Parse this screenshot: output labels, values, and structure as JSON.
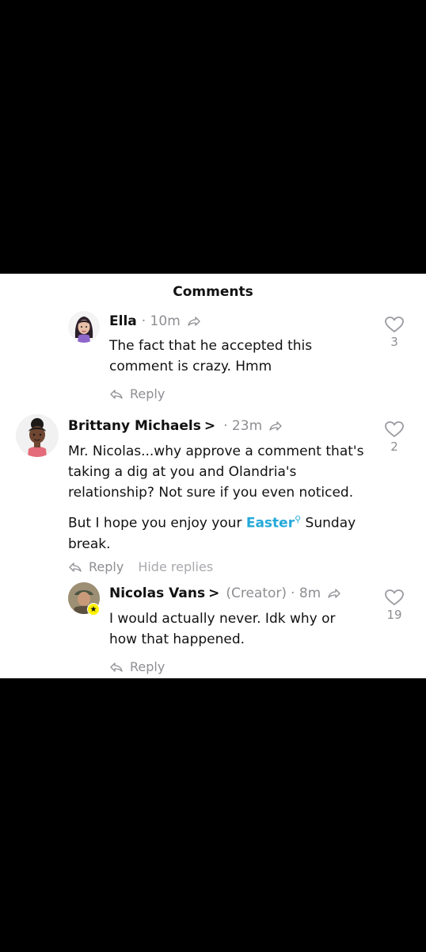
{
  "header": {
    "title": "Comments"
  },
  "comments": [
    {
      "name": "Ella",
      "time": "· 10m",
      "lines": [
        "The fact that he accepted this comment is crazy. Hmm"
      ],
      "likes": "3",
      "reply_label": "Reply"
    },
    {
      "name": "Brittany Michaels",
      "chevron": ">",
      "time": "· 23m",
      "para1": "Mr. Nicolas...why approve a comment that's taking a dig at you and Olandria's relationship? Not sure if you even noticed.",
      "para2_pre": "But I hope you enjoy your ",
      "para2_link": "Easter",
      "para2_post": " Sunday break.",
      "likes": "2",
      "reply_label": "Reply",
      "hide_label": "Hide replies"
    },
    {
      "name": "Nicolas Vans",
      "chevron": ">",
      "creator": "(Creator)",
      "time": "· 8m",
      "lines": [
        "I would actually never. Idk why or how that happened."
      ],
      "likes": "19",
      "reply_label": "Reply"
    }
  ],
  "icons": {
    "heart": "heart-outline-icon",
    "reply": "reply-arrow-icon",
    "share": "share-arrow-icon",
    "link_search": "search-icon"
  },
  "colors": {
    "link": "#23a9d9",
    "muted": "#8e8e93"
  }
}
